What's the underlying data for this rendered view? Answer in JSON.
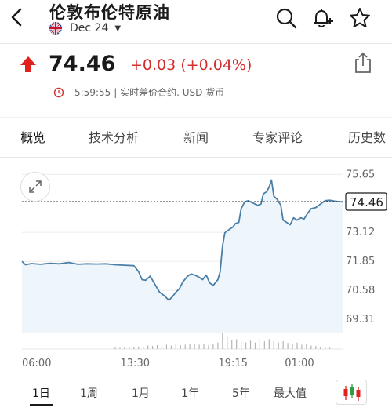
{
  "header": {
    "title": "伦敦布伦特原油",
    "contract_month": "Dec 24"
  },
  "quote": {
    "price": "74.46",
    "change": "+0.03 (+0.04%)",
    "direction": "up",
    "time": "5:59:55",
    "status_text": "| 实时差价合约.  USD 货币"
  },
  "tabs": [
    {
      "label": "概览",
      "active": true
    },
    {
      "label": "技术分析",
      "active": false
    },
    {
      "label": "新闻",
      "active": false
    },
    {
      "label": "专家评论",
      "active": false
    },
    {
      "label": "历史数",
      "active": false
    }
  ],
  "chart_data": {
    "type": "line",
    "current_price_label": "74.46",
    "y_ticks": [
      "75.65",
      "73.12",
      "71.85",
      "70.58",
      "69.31"
    ],
    "x_ticks": [
      "06:00",
      "13:30",
      "19:15",
      "01:00"
    ],
    "ylim": [
      68.7,
      75.9
    ],
    "reference_line": 74.46,
    "series": [
      {
        "values": [
          [
            0,
            71.85
          ],
          [
            1.5,
            71.7
          ],
          [
            4,
            71.75
          ],
          [
            8,
            71.72
          ],
          [
            12,
            71.76
          ],
          [
            16,
            71.74
          ],
          [
            20,
            71.8
          ],
          [
            24,
            71.72
          ],
          [
            28,
            71.74
          ],
          [
            32,
            71.73
          ],
          [
            36,
            71.74
          ],
          [
            40,
            71.7
          ],
          [
            44,
            71.68
          ],
          [
            48,
            71.66
          ],
          [
            50,
            71.4
          ],
          [
            51.5,
            71.05
          ],
          [
            53,
            71.02
          ],
          [
            55,
            71.2
          ],
          [
            57,
            70.85
          ],
          [
            59,
            70.5
          ],
          [
            61,
            70.35
          ],
          [
            63,
            70.15
          ],
          [
            64.5,
            70.3
          ],
          [
            66,
            70.5
          ],
          [
            67.5,
            70.65
          ],
          [
            69,
            70.95
          ],
          [
            71,
            71.2
          ],
          [
            72.5,
            71.3
          ],
          [
            74,
            71.25
          ],
          [
            76,
            71.15
          ],
          [
            77.5,
            71.05
          ],
          [
            79,
            71.25
          ],
          [
            80.5,
            70.9
          ],
          [
            82,
            70.8
          ],
          [
            84,
            71.05
          ],
          [
            85,
            71.4
          ],
          [
            86,
            72.5
          ],
          [
            87,
            73.1
          ],
          [
            89,
            73.25
          ],
          [
            90.5,
            73.35
          ],
          [
            91.5,
            73.5
          ],
          [
            93,
            73.55
          ],
          [
            94,
            74.15
          ],
          [
            95.5,
            74.45
          ],
          [
            97,
            74.5
          ],
          [
            99,
            74.4
          ],
          [
            101,
            74.3
          ],
          [
            102.5,
            74.35
          ],
          [
            103.5,
            74.8
          ],
          [
            105,
            74.9
          ],
          [
            106,
            75.1
          ],
          [
            107,
            75.4
          ],
          [
            108,
            74.7
          ],
          [
            109.5,
            74.55
          ],
          [
            111,
            74.3
          ],
          [
            112,
            73.65
          ],
          [
            113.5,
            73.55
          ],
          [
            115,
            73.45
          ],
          [
            116.5,
            73.75
          ],
          [
            118,
            73.65
          ],
          [
            119.5,
            73.75
          ],
          [
            121,
            73.7
          ],
          [
            122.5,
            73.95
          ],
          [
            124,
            74.15
          ],
          [
            126,
            74.2
          ],
          [
            128,
            74.35
          ],
          [
            130,
            74.5
          ],
          [
            132,
            74.52
          ],
          [
            134,
            74.48
          ],
          [
            136,
            74.46
          ],
          [
            137.5,
            74.45
          ]
        ]
      }
    ],
    "volume": [
      [
        40,
        0.08
      ],
      [
        42,
        0.05
      ],
      [
        44,
        0.1
      ],
      [
        46,
        0.07
      ],
      [
        48,
        0.09
      ],
      [
        50,
        0.12
      ],
      [
        52,
        0.11
      ],
      [
        54,
        0.16
      ],
      [
        56,
        0.14
      ],
      [
        58,
        0.18
      ],
      [
        60,
        0.15
      ],
      [
        62,
        0.2
      ],
      [
        64,
        0.16
      ],
      [
        66,
        0.22
      ],
      [
        68,
        0.18
      ],
      [
        70,
        0.2
      ],
      [
        72,
        0.25
      ],
      [
        74,
        0.22
      ],
      [
        76,
        0.2
      ],
      [
        78,
        0.23
      ],
      [
        80,
        0.18
      ],
      [
        82,
        0.21
      ],
      [
        84,
        0.3
      ],
      [
        86,
        1.0
      ],
      [
        88,
        0.55
      ],
      [
        90,
        0.4
      ],
      [
        92,
        0.45
      ],
      [
        94,
        0.35
      ],
      [
        96,
        0.3
      ],
      [
        98,
        0.38
      ],
      [
        100,
        0.3
      ],
      [
        102,
        0.42
      ],
      [
        104,
        0.35
      ],
      [
        106,
        0.45
      ],
      [
        108,
        0.38
      ],
      [
        110,
        0.3
      ],
      [
        112,
        0.36
      ],
      [
        114,
        0.28
      ],
      [
        116,
        0.25
      ],
      [
        118,
        0.3
      ],
      [
        120,
        0.2
      ],
      [
        122,
        0.22
      ],
      [
        124,
        0.16
      ],
      [
        126,
        0.14
      ],
      [
        128,
        0.1
      ],
      [
        130,
        0.08
      ],
      [
        132,
        0.06
      ]
    ]
  },
  "ranges": [
    {
      "label": "1日",
      "active": true
    },
    {
      "label": "1周",
      "active": false
    },
    {
      "label": "1月",
      "active": false
    },
    {
      "label": "1年",
      "active": false
    },
    {
      "label": "5年",
      "active": false
    },
    {
      "label": "最大值",
      "active": false
    }
  ],
  "colors": {
    "up_red": "#e0211d",
    "change_red": "#d32f2f",
    "line_blue": "#4a7fa8",
    "area_fill": "#eef5fb",
    "candle_red": "#e0211d",
    "candle_green": "#2e9e44"
  },
  "icons": {
    "back": "chevron-left-icon",
    "flag": "uk-flag-icon",
    "search": "search-icon",
    "alert": "bell-plus-icon",
    "watchlist": "star-icon",
    "share": "share-icon",
    "expand": "expand-icon",
    "chart_type": "candlestick-icon",
    "clock": "clock-icon"
  }
}
